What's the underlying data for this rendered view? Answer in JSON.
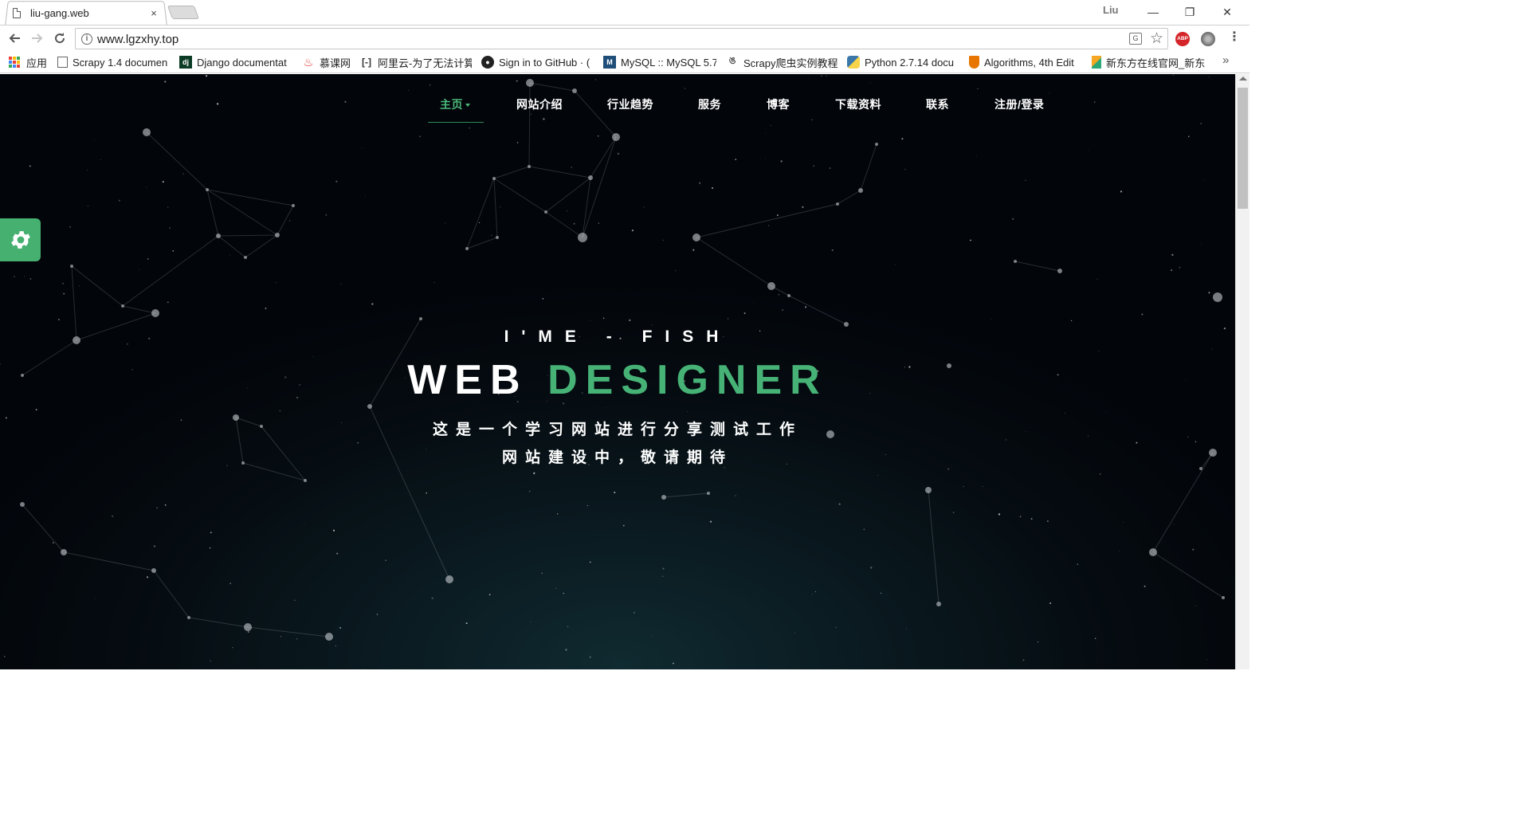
{
  "browser": {
    "tab_title": "liu-gang.web",
    "tab_close": "×",
    "profile_name": "Liu",
    "window_controls": {
      "minimize": "—",
      "maximize": "❐",
      "close": "✕"
    },
    "url": "www.lgzxhy.top",
    "icons": {
      "back": "arrow-left-icon",
      "forward": "arrow-right-icon",
      "reload": "reload-icon",
      "info": "info-icon",
      "translate": "translate-icon",
      "bookmark": "star-icon",
      "adblock": "abp-icon",
      "extension": "globe-extension-icon",
      "menu": "kebab-menu-icon"
    },
    "adblock_label": "ABP",
    "bookmarks": [
      {
        "label": "应用",
        "icon": "apps-grid-icon"
      },
      {
        "label": "Scrapy 1.4 documen",
        "icon": "document-icon"
      },
      {
        "label": "Django documentat",
        "icon": "django-icon"
      },
      {
        "label": "慕课网",
        "icon": "flame-icon"
      },
      {
        "label": "阿里云-为了无法计算",
        "icon": "aliyun-icon"
      },
      {
        "label": "Sign in to GitHub · (",
        "icon": "github-icon"
      },
      {
        "label": "MySQL :: MySQL 5.7",
        "icon": "mysql-icon"
      },
      {
        "label": "Scrapy爬虫实例教程",
        "icon": "scrapy-icon"
      },
      {
        "label": "Python 2.7.14 docu",
        "icon": "python-icon"
      },
      {
        "label": "Algorithms, 4th Edit",
        "icon": "princeton-shield-icon"
      },
      {
        "label": "新东方在线官网_新东",
        "icon": "xdf-icon"
      }
    ],
    "bookmarks_overflow": "»"
  },
  "site": {
    "nav": [
      {
        "label": "主页",
        "active": true
      },
      {
        "label": "网站介绍",
        "active": false
      },
      {
        "label": "行业趋势",
        "active": false
      },
      {
        "label": "服务",
        "active": false
      },
      {
        "label": "博客",
        "active": false
      },
      {
        "label": "下载资料",
        "active": false
      },
      {
        "label": "联系",
        "active": false
      },
      {
        "label": "注册/登录",
        "active": false
      }
    ],
    "settings_icon": "gear-icon",
    "hero": {
      "subtitle": "I'ME - FISH",
      "title_word1": "WEB",
      "title_word2": "DESIGNER",
      "line1": "这是一个学习网站进行分享测试工作",
      "line2": "网站建设中，敬请期待"
    },
    "colors": {
      "accent_green": "#46b276",
      "background_dark": "#050b10"
    }
  }
}
